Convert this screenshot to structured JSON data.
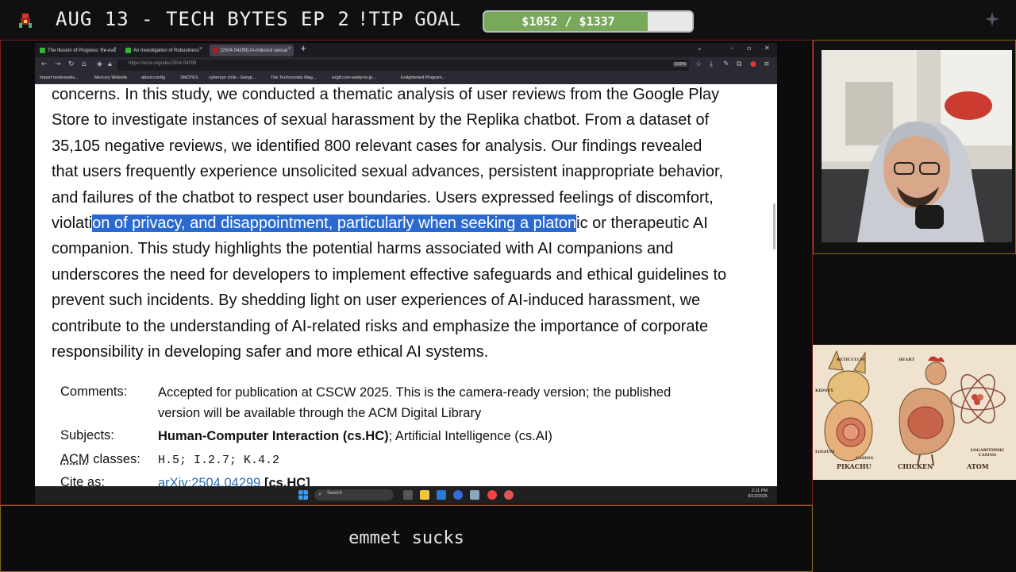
{
  "overlay": {
    "title": "AUG 13 - TECH BYTES EP 2",
    "tip_goal_label": "!TIP GOAL",
    "tip_goal_text": "$1052 / $1337",
    "tip_goal_progress": 0.787,
    "caption": "emmet sucks"
  },
  "browser": {
    "tabs": [
      {
        "label": "The Illusion of Progress: Re-eva"
      },
      {
        "label": "An Investigation of Robustness"
      },
      {
        "label": "[2504.04299] AI-induced sexual"
      }
    ],
    "new_tab": "+",
    "url": "https://arxiv.org/abs/2504.04299",
    "zoom": "320%",
    "bookmarks": [
      "Import bookmarks...",
      "Mercury Website",
      "about:config",
      "SNOTES",
      "cybersyn chile - Googl...",
      "The Technocrats Mag...",
      "ezgif.com-webp-to-jp...",
      "Enlightened Program..."
    ],
    "taskbar_search": "Search",
    "clock_time": "2:11 PM",
    "clock_date": "8/13/2025"
  },
  "abstract": {
    "l1": "concerns. In this study, we conducted a thematic analysis of user reviews from the Google Play",
    "l2": "Store to investigate instances of sexual harassment by the Replika chatbot. From a dataset of",
    "l3": "35,105 negative reviews, we identified 800 relevant cases for analysis. Our findings revealed",
    "l4": "that users frequently experience unsolicited sexual advances, persistent inappropriate behavior,",
    "l5": "and failures of the chatbot to respect user boundaries. Users expressed feelings of discomfort,",
    "l6a": "violati",
    "l6b": "on of privacy, and disappointment, particularly when seeking a platon",
    "l6c": "ic or therapeutic AI",
    "l7": "companion. This study highlights the potential harms associated with AI companions and",
    "l8": "underscores the need for developers to implement effective safeguards and ethical guidelines to",
    "l9": "prevent such incidents. By shedding light on user experiences of AI-induced harassment, we",
    "l10": "contribute to the understanding of AI-related risks and emphasize the importance of corporate",
    "l11": "responsibility in developing safer and more ethical AI systems."
  },
  "meta": {
    "comments_label": "Comments:",
    "comments_l1": "Accepted for publication at CSCW 2025. This is the camera-ready version; the published",
    "comments_l2": "version will be available through the ACM Digital Library",
    "subjects_label": "Subjects:",
    "subjects_primary": "Human-Computer Interaction (cs.HC)",
    "subjects_rest": "; Artificial Intelligence (cs.AI)",
    "acm_label_abbr": "ACM",
    "acm_label_rest": " classes:",
    "acm_value": "H.5; I.2.7; K.4.2",
    "cite_label": "Cite as:",
    "cite_link": "arXiv:2504.04299",
    "cite_cat": "[cs.HC]"
  },
  "art": {
    "captions": [
      "PIKACHU",
      "CHICKEN",
      "ATOM"
    ],
    "labels": [
      "RETICULUM",
      "HEART",
      "KIDNEY",
      "LOGARITHMIC CASING",
      "LOGIUM",
      "CASING"
    ]
  },
  "colors": {
    "highlight": "#2a6ad0",
    "goal_fill": "#78a95a",
    "link": "#2b6cb3",
    "screen_border": "#7a1d1d",
    "cam_border": "#8a6a1a"
  }
}
